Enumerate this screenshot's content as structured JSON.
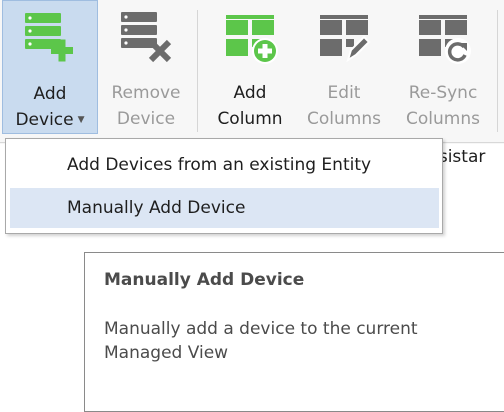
{
  "ribbon": {
    "buttons": [
      {
        "label_line1": "Add",
        "label_line2": "Device",
        "icon": "add-device-icon",
        "state": "active",
        "has_dropdown": true
      },
      {
        "label_line1": "Remove",
        "label_line2": "Device",
        "icon": "remove-device-icon",
        "state": "disabled"
      },
      {
        "label_line1": "Add",
        "label_line2": "Column",
        "icon": "add-column-icon",
        "state": "enabled"
      },
      {
        "label_line1": "Edit",
        "label_line2": "Columns",
        "icon": "edit-columns-icon",
        "state": "disabled"
      },
      {
        "label_line1": "Re-Sync",
        "label_line2": "Columns",
        "icon": "resync-columns-icon",
        "state": "disabled"
      }
    ],
    "clipped_text": "ssistar"
  },
  "dropdown_menu": {
    "items": [
      {
        "label": "Add Devices from an existing Entity"
      },
      {
        "label": "Manually Add Device",
        "highlighted": true
      }
    ]
  },
  "tooltip": {
    "title": "Manually Add Device",
    "description": "Manually add a device to the current Managed View"
  },
  "colors": {
    "accent_green": "#5cc64a",
    "icon_gray": "#6c6c6c",
    "active_button_bg": "#c9dbef",
    "menu_highlight": "#dce6f4"
  }
}
